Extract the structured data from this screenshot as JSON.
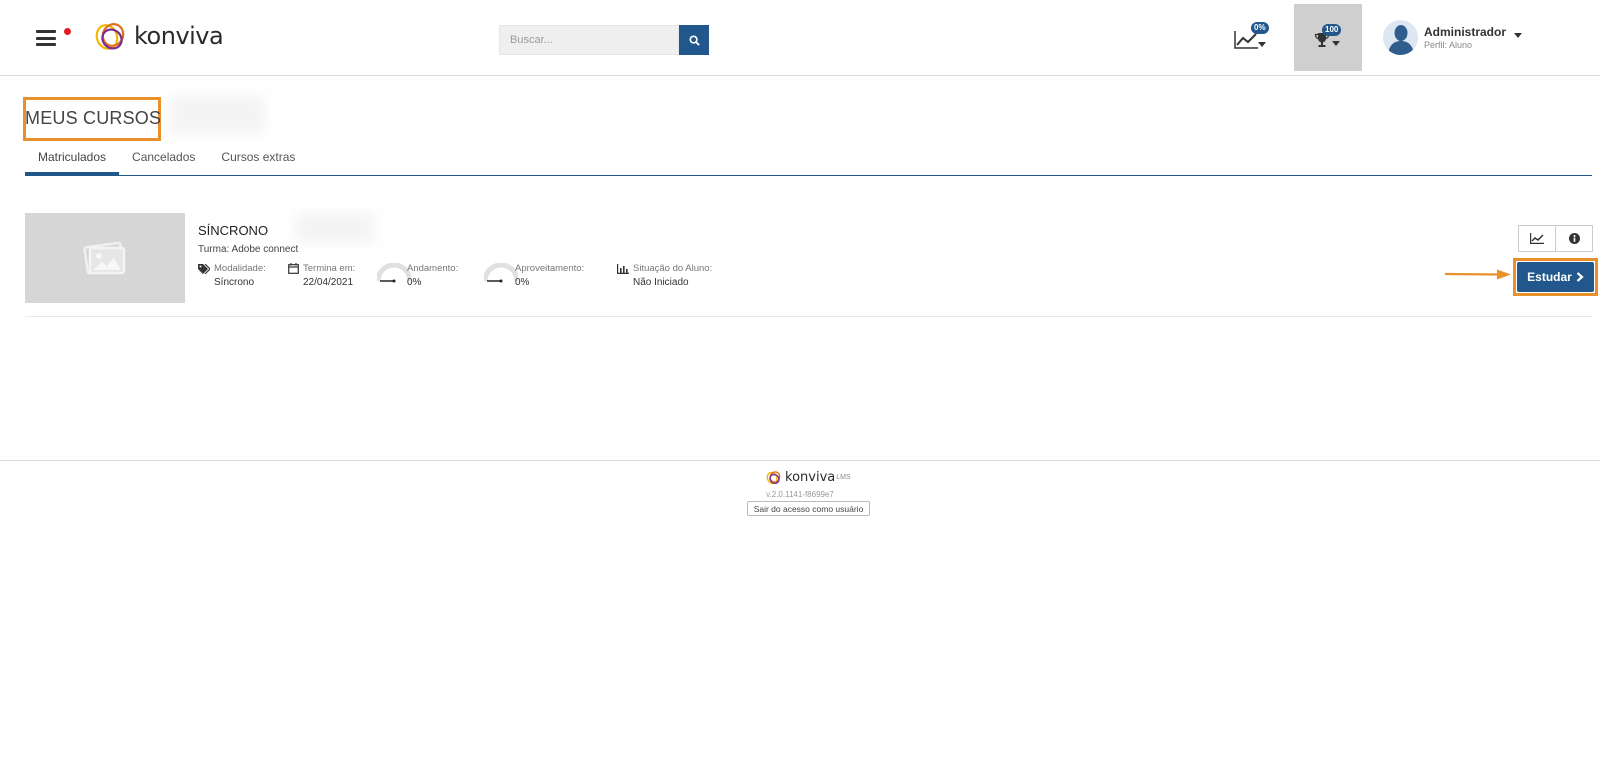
{
  "header": {
    "logo_text": "konviva",
    "search": {
      "placeholder": "Buscar..."
    },
    "progress_badge": "0%",
    "trophy_badge": "100",
    "user": {
      "name": "Administrador",
      "role": "Perfil: Aluno"
    }
  },
  "page": {
    "title": "MEUS CURSOS",
    "tabs": [
      {
        "label": "Matriculados",
        "active": true
      },
      {
        "label": "Cancelados",
        "active": false
      },
      {
        "label": "Cursos extras",
        "active": false
      }
    ]
  },
  "course": {
    "title": "SÍNCRONO",
    "turma": "Turma: Adobe connect",
    "modalidade": {
      "label": "Modalidade:",
      "value": "Síncrono"
    },
    "termina": {
      "label": "Termina em:",
      "value": "22/04/2021"
    },
    "andamento": {
      "label": "Andamento:",
      "value": "0%",
      "percent": 0
    },
    "aproveitamento": {
      "label": "Aproveitamento:",
      "value": "0%",
      "percent": 0
    },
    "situacao": {
      "label": "Situação do Aluno:",
      "value": "Não Iniciado"
    },
    "study_label": "Estudar"
  },
  "footer": {
    "logo_text": "konviva",
    "lms": "LMS",
    "version": "v.2.0.1141-f8699e7",
    "exit_label": "Sair do acesso como usuário"
  },
  "colors": {
    "primary": "#21578c",
    "highlight": "#e8912b",
    "notification": "#e31b23"
  }
}
